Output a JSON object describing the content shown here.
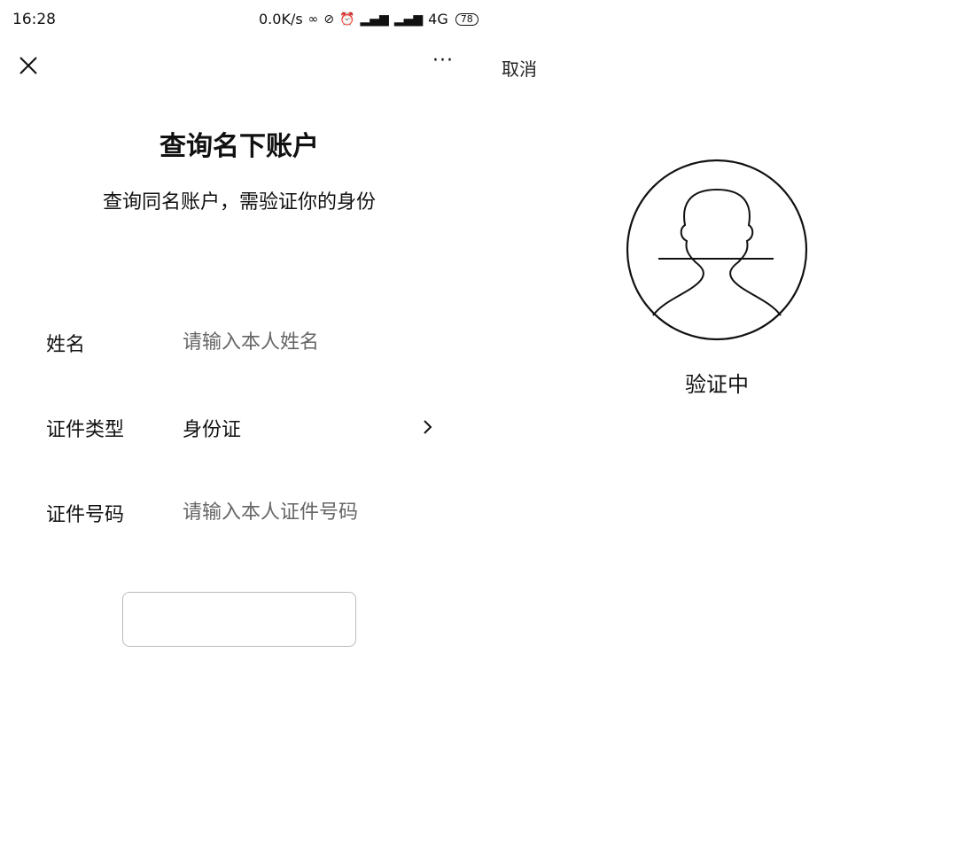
{
  "status_bar": {
    "time": "16:28",
    "net_speed": "0.0K/s",
    "signal_text": "4G",
    "battery": "78"
  },
  "nav": {
    "more_label": "···",
    "cancel_label": "取消"
  },
  "header": {
    "title": "查询名下账户",
    "subtitle": "查询同名账户，需验证你的身份"
  },
  "form": {
    "name": {
      "label": "姓名",
      "placeholder": "请输入本人姓名",
      "value": ""
    },
    "id_type": {
      "label": "证件类型",
      "value": "身份证"
    },
    "id_number": {
      "label": "证件号码",
      "placeholder": "请输入本人证件号码",
      "value": ""
    },
    "submit_label": ""
  },
  "verification": {
    "status": "验证中"
  },
  "icons": {
    "close": "close-icon",
    "more": "more-icon",
    "chevron": "chevron-right-icon",
    "face": "face-outline-icon"
  }
}
